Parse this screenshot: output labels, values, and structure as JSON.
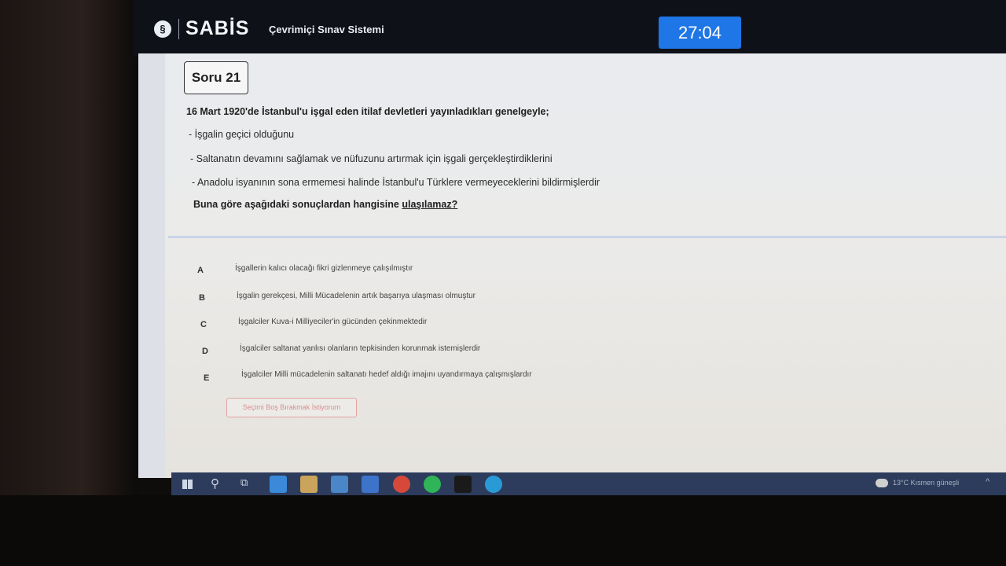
{
  "header": {
    "logo_glyph": "§",
    "brand": "SABİS",
    "system_title": "Çevrimiçi Sınav Sistemi",
    "timer": "27:04"
  },
  "question": {
    "label": "Soru 21",
    "intro": "16 Mart 1920'de İstanbul'u işgal eden itilaf devletleri yayınladıkları genelgeyle;",
    "bullets": [
      "- İşgalin geçici olduğunu",
      "- Saltanatın devamını sağlamak ve nüfuzunu artırmak için işgali gerçekleştirdiklerini",
      "- Anadolu isyanının sona ermemesi halinde İstanbul'u Türklere vermeyeceklerini bildirmişlerdir"
    ],
    "prompt_start": "Buna göre aşağıdaki sonuçlardan hangisine ",
    "prompt_underlined": "ulaşılamaz?"
  },
  "options": [
    {
      "letter": "A",
      "text": "İşgallerin kalıcı olacağı fikri gizlenmeye çalışılmıştır"
    },
    {
      "letter": "B",
      "text": "İşgalin gerekçesi, Milli Mücadelenin artık başarıya ulaşması olmuştur"
    },
    {
      "letter": "C",
      "text": "İşgalciler Kuva-i Milliyeciler'in gücünden çekinmektedir"
    },
    {
      "letter": "D",
      "text": "İşgalciler saltanat yanlısı olanların tepkisinden korunmak istemişlerdir"
    },
    {
      "letter": "E",
      "text": "İşgalciler Milli mücadelenin saltanatı hedef aldığı imajını uyandırmaya çalışmışlardır"
    }
  ],
  "blank_button": "Seçimi Boş Bırakmak İstiyorum",
  "taskbar": {
    "weather": "13°C Kısmen güneşli",
    "icons": [
      "windows-start-icon",
      "search-icon",
      "task-view-icon",
      "app-l-icon",
      "file-explorer-icon",
      "mail-icon",
      "app-arrow-icon",
      "chrome-icon",
      "whatsapp-icon",
      "netflix-icon",
      "edge-icon"
    ]
  },
  "colors": {
    "timer_bg": "#1f76e6",
    "header_bg": "#0e1117",
    "taskbar_bg": "#2d3c5c",
    "blank_button_border": "#e3a3a3"
  }
}
